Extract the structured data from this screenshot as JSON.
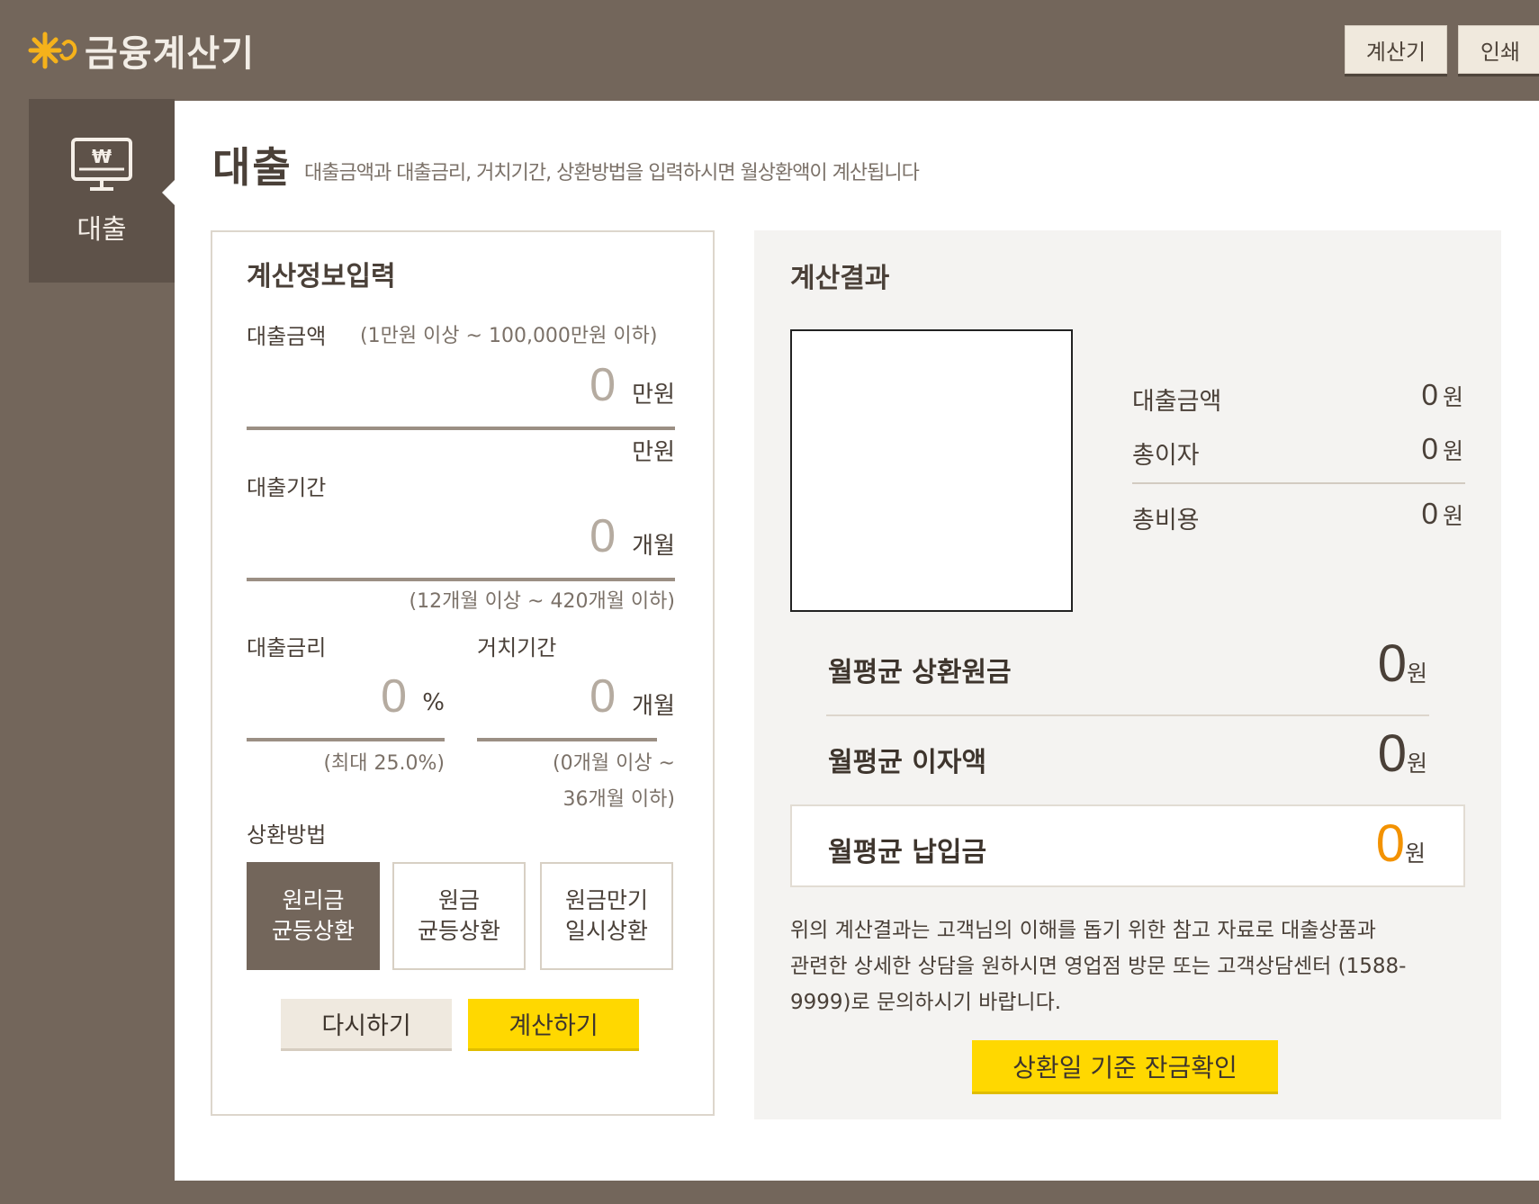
{
  "header": {
    "brand": "금융계산기",
    "buttons": {
      "calculator": "계산기",
      "print": "인쇄"
    }
  },
  "nav": {
    "active_label": "대출",
    "icon": "monitor-won-icon"
  },
  "page": {
    "title": "대출",
    "description": "대출금액과 대출금리, 거치기간, 상환방법을 입력하시면 월상환액이 계산됩니다"
  },
  "input": {
    "section_title": "계산정보입력",
    "loan_amount": {
      "label": "대출금액",
      "hint": "(1만원 이상 ~ 100,000만원 이하)",
      "value": "0",
      "unit": "만원",
      "below": "만원"
    },
    "loan_period": {
      "label": "대출기간",
      "value": "0",
      "unit": "개월",
      "hint": "(12개월 이상 ~ 420개월 이하)"
    },
    "interest_rate": {
      "label": "대출금리",
      "value": "0",
      "unit": "%",
      "hint": "(최대 25.0%)"
    },
    "grace_period": {
      "label": "거치기간",
      "value": "0",
      "unit": "개월",
      "hint1": "(0개월 이상 ~",
      "hint2": "36개월 이하)"
    },
    "method": {
      "label": "상환방법",
      "options": [
        {
          "line1": "원리금",
          "line2": "균등상환",
          "selected": true
        },
        {
          "line1": "원금",
          "line2": "균등상환",
          "selected": false
        },
        {
          "line1": "원금만기",
          "line2": "일시상환",
          "selected": false
        }
      ]
    },
    "reset_label": "다시하기",
    "calc_label": "계산하기"
  },
  "result": {
    "section_title": "계산결과",
    "summary": [
      {
        "label": "대출금액",
        "value": "0",
        "unit": "원"
      },
      {
        "label": "총이자",
        "value": "0",
        "unit": "원"
      },
      {
        "label": "총비용",
        "value": "0",
        "unit": "원"
      }
    ],
    "monthly": [
      {
        "label": "월평균 상환원금",
        "value": "0",
        "unit": "원"
      },
      {
        "label": "월평균 이자액",
        "value": "0",
        "unit": "원"
      },
      {
        "label": "월평균 납입금",
        "value": "0",
        "unit": "원"
      }
    ],
    "note_lines": [
      "위의 계산결과는 고객님의 이해를 돕기 위한 참고 자료로 대출상품과",
      "관련한 상세한 상담을 원하시면 영업점 방문 또는 고객상담센터 (1588-",
      "9999)로 문의하시기 바랍니다."
    ],
    "balance_button": "상환일 기준 잔금확인"
  },
  "colors": {
    "brand_bg": "#73665b",
    "accent_yellow": "#ffd800",
    "highlight_orange": "#f39200",
    "logo_star": "#f5b21b"
  }
}
